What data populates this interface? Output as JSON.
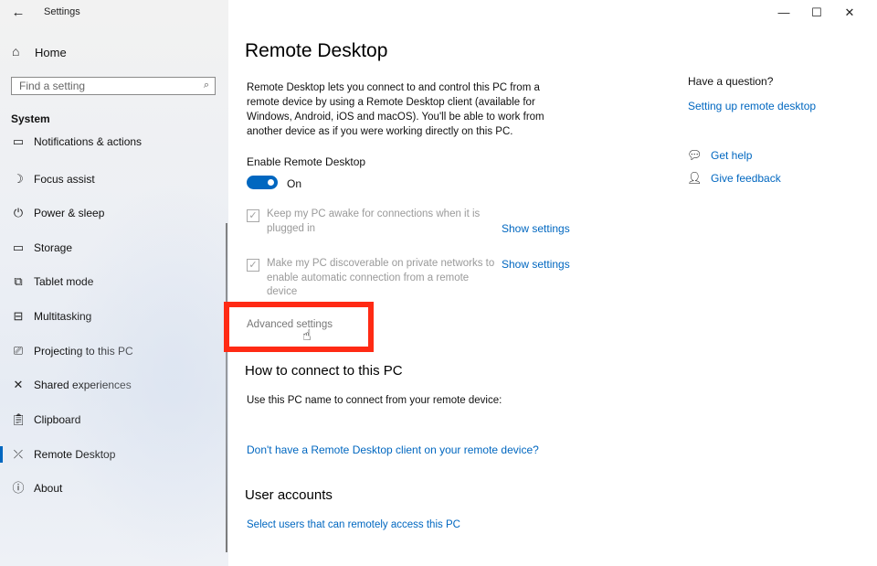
{
  "window": {
    "title": "Settings",
    "minimize": "—",
    "maximize": "☐",
    "close": "✕"
  },
  "sidebar": {
    "back_icon": "back-arrow-icon",
    "home_label": "Home",
    "search_placeholder": "Find a setting",
    "section_title": "System",
    "items": [
      {
        "label": "Notifications & actions",
        "icon": "notifications-icon"
      },
      {
        "label": "Focus assist",
        "icon": "moon-icon"
      },
      {
        "label": "Power & sleep",
        "icon": "power-icon"
      },
      {
        "label": "Storage",
        "icon": "storage-icon"
      },
      {
        "label": "Tablet mode",
        "icon": "tablet-icon"
      },
      {
        "label": "Multitasking",
        "icon": "multitasking-icon"
      },
      {
        "label": "Projecting to this PC",
        "icon": "projector-icon"
      },
      {
        "label": "Shared experiences",
        "icon": "shared-icon"
      },
      {
        "label": "Clipboard",
        "icon": "clipboard-icon"
      },
      {
        "label": "Remote Desktop",
        "icon": "remote-desktop-icon"
      },
      {
        "label": "About",
        "icon": "info-icon"
      }
    ],
    "active_item": "Remote Desktop"
  },
  "main": {
    "title": "Remote Desktop",
    "description": "Remote Desktop lets you connect to and control this PC from a remote device by using a Remote Desktop client (available for Windows, Android, iOS and macOS). You'll be able to work from another device as if you were working directly on this PC.",
    "enable_label": "Enable Remote Desktop",
    "toggle_state": "On",
    "option1_label": "Keep my PC awake for connections when it is plugged in",
    "option2_label": "Make my PC discoverable on private networks to enable automatic connection from a remote device",
    "show_settings": "Show settings",
    "advanced_settings": "Advanced settings",
    "how_to_connect": "How to connect to this PC",
    "use_pc_name": "Use this PC name to connect from your remote device:",
    "client_link": "Don't have a Remote Desktop client on your remote device?",
    "user_accounts": "User accounts",
    "select_users": "Select users that can remotely access this PC"
  },
  "help": {
    "question": "Have a question?",
    "setup_link": "Setting up remote desktop",
    "get_help": "Get help",
    "give_feedback": "Give feedback"
  },
  "colors": {
    "accent": "#0067c0",
    "highlight": "#ff2a14"
  }
}
